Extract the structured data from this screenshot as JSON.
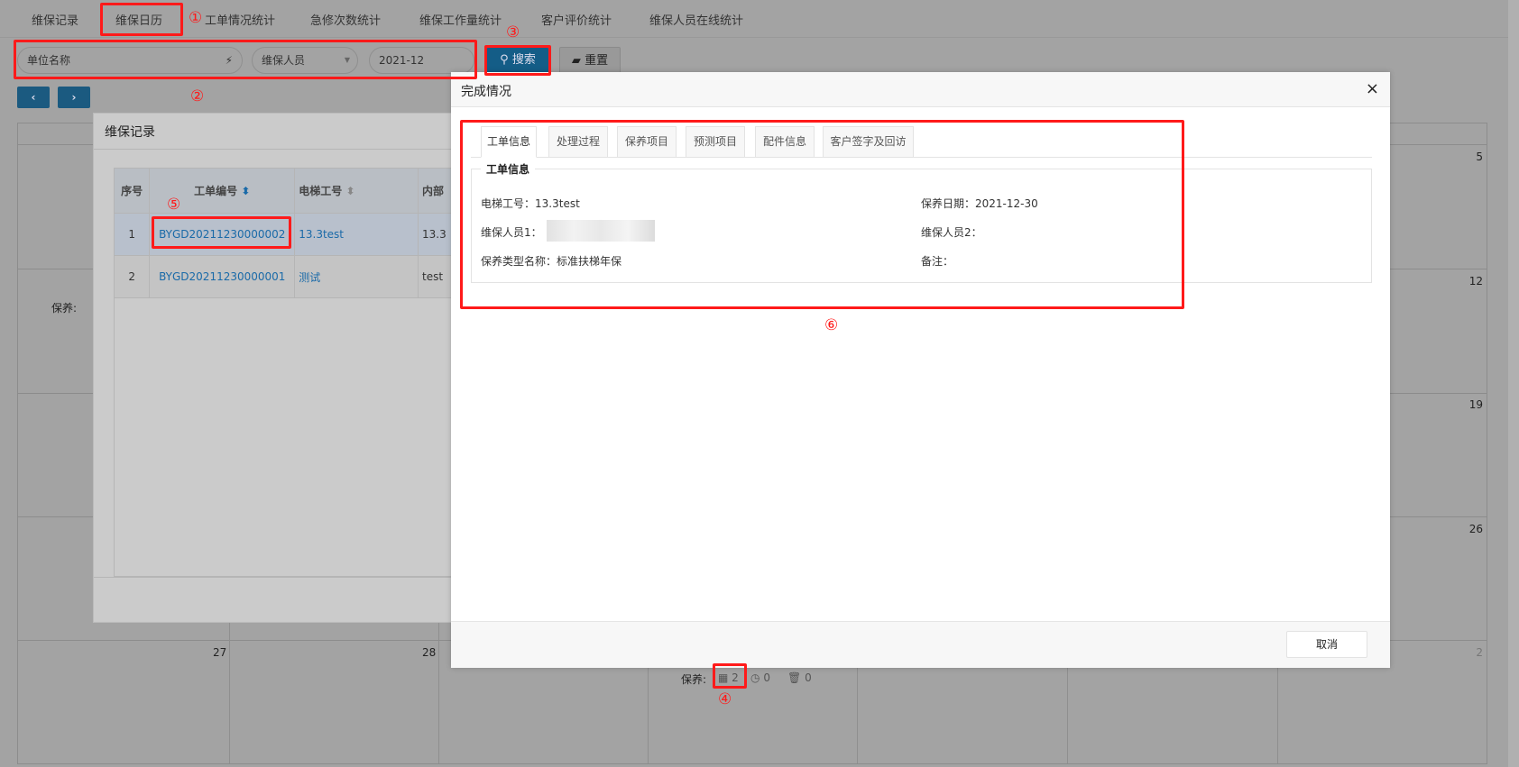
{
  "nav_tabs": [
    "维保记录",
    "维保日历",
    "工单情况统计",
    "急修次数统计",
    "维保工作量统计",
    "客户评价统计",
    "维保人员在线统计"
  ],
  "filters": {
    "unit_placeholder": "单位名称",
    "staff_placeholder": "维保人员",
    "month_value": "2021-12",
    "search_label": "搜索",
    "reset_label": "重置"
  },
  "calendar": {
    "dates": {
      "r1": "5",
      "r2": "12",
      "r3": "19",
      "r4": "26",
      "r5c1": "27",
      "r5c2": "28",
      "r5c7": "2"
    },
    "maintenance_label": "保养:",
    "stats": {
      "orders": "2",
      "pending": "0",
      "deleted": "0"
    }
  },
  "records_dialog": {
    "title": "维保记录",
    "headers": [
      "序号",
      "工单编号",
      "电梯工号",
      "内部"
    ],
    "rows": [
      [
        "1",
        "BYGD20211230000002",
        "13.3test",
        "13.3"
      ],
      [
        "2",
        "BYGD20211230000001",
        "测试",
        "test"
      ]
    ]
  },
  "completion_modal": {
    "title": "完成情况",
    "close": "×",
    "tabs": [
      "工单信息",
      "处理过程",
      "保养项目",
      "预测项目",
      "配件信息",
      "客户签字及回访"
    ],
    "legend": "工单信息",
    "fields": {
      "elevator_label": "电梯工号：",
      "elevator_value": "13.3test",
      "date_label": "保养日期：",
      "date_value": "2021-12-30",
      "staff1_label": "维保人员1：",
      "staff2_label": "维保人员2：",
      "type_label": "保养类型名称：",
      "type_value": "标准扶梯年保",
      "remark_label": "备注："
    },
    "cancel_label": "取消"
  },
  "annotations": [
    "①",
    "②",
    "③",
    "④",
    "⑤",
    "⑥"
  ],
  "colors": {
    "annotation": "#ff1a1a",
    "link": "#1a6aa8",
    "primary": "#1b5a80"
  }
}
